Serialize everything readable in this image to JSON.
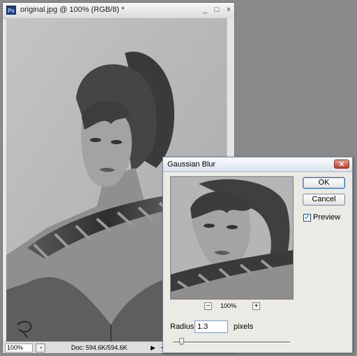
{
  "document_window": {
    "title": "original.jpg @ 100% (RGB/8) *",
    "app_icon": "Ps",
    "minimize_glyph": "_",
    "maximize_glyph": "□",
    "close_glyph": "×",
    "status": {
      "zoom": "100%",
      "doc_info": "Doc: 594.6K/594.6K",
      "menu_arrow": "▶"
    }
  },
  "dialog": {
    "title": "Gaussian Blur",
    "close_glyph": "✕",
    "ok_label": "OK",
    "cancel_label": "Cancel",
    "preview_checked": true,
    "preview_label": "Preview",
    "zoom_out_glyph": "−",
    "zoom_in_glyph": "+",
    "zoom_level": "100%",
    "radius_label": "Radius:",
    "radius_value": "1.3",
    "units_label": "pixels",
    "slider_fraction": 0.07
  },
  "colors": {
    "dialog_bg": "#eceae4",
    "accent": "#3c6bb6",
    "close_red": "#c2402a"
  }
}
